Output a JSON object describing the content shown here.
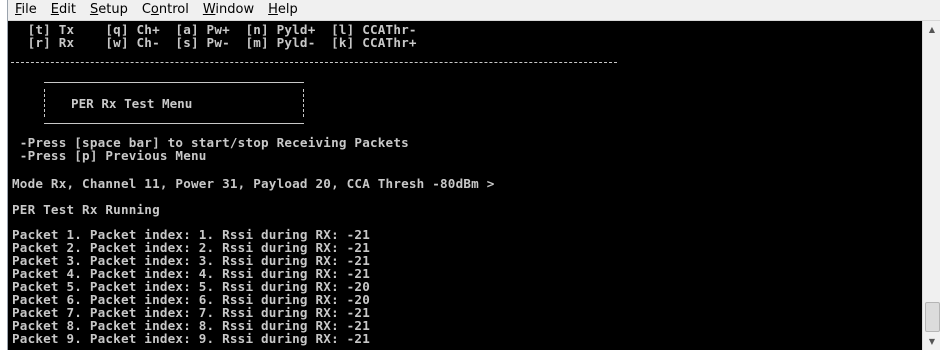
{
  "menu": [
    {
      "pre": "",
      "u": "F",
      "post": "ile"
    },
    {
      "pre": "",
      "u": "E",
      "post": "dit"
    },
    {
      "pre": "",
      "u": "S",
      "post": "etup"
    },
    {
      "pre": "C",
      "u": "o",
      "post": "ntrol"
    },
    {
      "pre": "",
      "u": "W",
      "post": "indow"
    },
    {
      "pre": "",
      "u": "H",
      "post": "elp"
    }
  ],
  "terminal": {
    "shortcuts_row1": "  [t] Tx    [q] Ch+  [a] Pw+  [n] Pyld+  [l] CCAThr-",
    "shortcuts_row2": "  [r] Rx    [w] Ch-  [s] Pw-  [m] Pyld-  [k] CCAThr+",
    "menu_title": "PER Rx Test Menu",
    "instruction1": " -Press [space bar] to start/stop Receiving Packets",
    "instruction2": " -Press [p] Previous Menu",
    "status_line": "Mode Rx, Channel 11, Power 31, Payload 20, CCA Thresh -80dBm >",
    "running_line": "PER Test Rx Running",
    "packets": [
      "Packet 1. Packet index: 1. Rssi during RX: -21",
      "Packet 2. Packet index: 2. Rssi during RX: -21",
      "Packet 3. Packet index: 3. Rssi during RX: -21",
      "Packet 4. Packet index: 4. Rssi during RX: -21",
      "Packet 5. Packet index: 5. Rssi during RX: -20",
      "Packet 6. Packet index: 6. Rssi during RX: -20",
      "Packet 7. Packet index: 7. Rssi during RX: -21",
      "Packet 8. Packet index: 8. Rssi during RX: -21",
      "Packet 9. Packet index: 9. Rssi during RX: -21"
    ]
  },
  "scrollbar": {
    "up_icon": "▲",
    "down_icon": "▼"
  },
  "colors": {
    "terminal_bg": "#000000",
    "terminal_text": "#c8c8c8",
    "menubar_bg": "#f0f0f0"
  }
}
